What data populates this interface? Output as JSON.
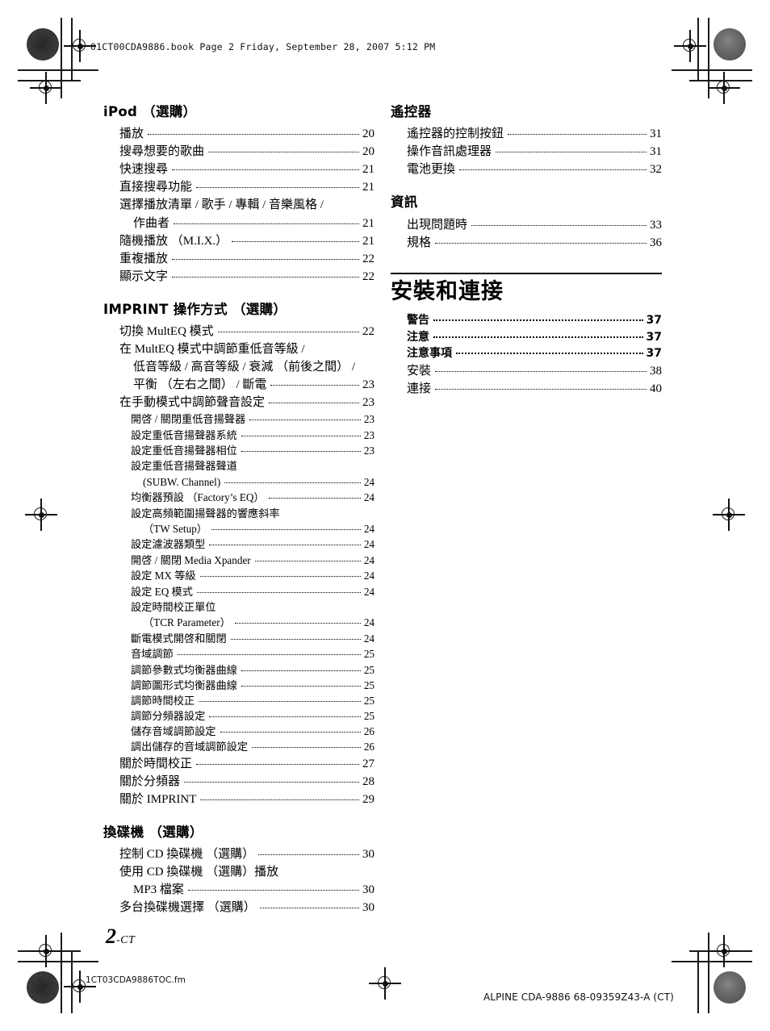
{
  "page": {
    "book_header": "01CT00CDA9886.book  Page 2  Friday, September 28, 2007  5:12 PM",
    "folio_number": "2",
    "folio_suffix": "-CT",
    "footer_file": "1CT03CDA9886TOC.fm",
    "footer_right": "ALPINE CDA-9886 68-09359Z43-A (CT)"
  },
  "left_column": {
    "sections": [
      {
        "title": "iPod （選購）",
        "entries": [
          {
            "label": "播放",
            "page": "20",
            "level": 1
          },
          {
            "label": "搜尋想要的歌曲",
            "page": "20",
            "level": 1
          },
          {
            "label": "快速搜尋",
            "page": "21",
            "level": 1
          },
          {
            "label": "直接搜尋功能",
            "page": "21",
            "level": 1
          },
          {
            "label": "選擇播放清單 / 歌手 / 專輯 / 音樂風格 /",
            "cont": "作曲者",
            "page": "21",
            "level": 1
          },
          {
            "label": "隨機播放 （M.I.X.）",
            "page": "21",
            "level": 1
          },
          {
            "label": "重複播放",
            "page": "22",
            "level": 1
          },
          {
            "label": "顯示文字",
            "page": "22",
            "level": 1
          }
        ]
      },
      {
        "title": "IMPRINT 操作方式 （選購）",
        "entries": [
          {
            "label": "切換 MultEQ 模式",
            "page": "22",
            "level": 1
          },
          {
            "label": "在 MultEQ 模式中調節重低音等級 /",
            "cont": "低音等級 / 高音等級 / 衰減 （前後之間） /",
            "cont2": "平衡 （左右之間） / 斷電",
            "page": "23",
            "level": 1
          },
          {
            "label": "在手動模式中調節聲音設定",
            "page": "23",
            "level": 1
          },
          {
            "label": "開啓 / 關閉重低音揚聲器",
            "page": "23",
            "level": 2
          },
          {
            "label": "設定重低音揚聲器系統",
            "page": "23",
            "level": 2
          },
          {
            "label": "設定重低音揚聲器相位",
            "page": "23",
            "level": 2
          },
          {
            "label": "設定重低音揚聲器聲道",
            "cont": "(SUBW. Channel)",
            "page": "24",
            "level": 2
          },
          {
            "label": "均衡器預設 （Factory’s EQ）",
            "page": "24",
            "level": 2
          },
          {
            "label": "設定高頻範圍揚聲器的響應斜率",
            "cont": "（TW Setup）",
            "page": "24",
            "level": 2
          },
          {
            "label": "設定濾波器類型",
            "page": "24",
            "level": 2
          },
          {
            "label": "開啓 / 關閉 Media Xpander",
            "page": "24",
            "level": 2
          },
          {
            "label": "設定 MX 等級",
            "page": "24",
            "level": 2
          },
          {
            "label": "設定 EQ 模式",
            "page": "24",
            "level": 2
          },
          {
            "label": "設定時間校正單位",
            "cont": "（TCR Parameter）",
            "page": "24",
            "level": 2
          },
          {
            "label": "斷電模式開啓和關閉",
            "page": "24",
            "level": 2
          },
          {
            "label": "音域調節",
            "page": "25",
            "level": 2
          },
          {
            "label": "調節參數式均衡器曲線",
            "page": "25",
            "level": 3
          },
          {
            "label": "調節圖形式均衡器曲線",
            "page": "25",
            "level": 3
          },
          {
            "label": "調節時間校正",
            "page": "25",
            "level": 3
          },
          {
            "label": "調節分頻器設定",
            "page": "25",
            "level": 3
          },
          {
            "label": "儲存音域調節設定",
            "page": "26",
            "level": 3
          },
          {
            "label": "調出儲存的音域調節設定",
            "page": "26",
            "level": 3
          },
          {
            "label": "關於時間校正",
            "page": "27",
            "level": 1
          },
          {
            "label": "關於分頻器",
            "page": "28",
            "level": 1
          },
          {
            "label": "關於 IMPRINT",
            "page": "29",
            "level": 1
          }
        ]
      },
      {
        "title": "換碟機 （選購）",
        "entries": [
          {
            "label": "控制 CD 換碟機 （選購）",
            "page": "30",
            "level": 1
          },
          {
            "label": "使用 CD 換碟機 （選購）播放",
            "cont": "MP3 檔案",
            "page": "30",
            "level": 1
          },
          {
            "label": "多台換碟機選擇 （選購）",
            "page": "30",
            "level": 1
          }
        ]
      }
    ]
  },
  "right_column": {
    "sections": [
      {
        "title": "遙控器",
        "entries": [
          {
            "label": "遙控器的控制按鈕",
            "page": "31",
            "level": 1
          },
          {
            "label": "操作音訊處理器",
            "page": "31",
            "level": 1
          },
          {
            "label": "電池更換",
            "page": "32",
            "level": 1
          }
        ]
      },
      {
        "title": "資訊",
        "entries": [
          {
            "label": "出現問題時",
            "page": "33",
            "level": 1
          },
          {
            "label": "規格",
            "page": "36",
            "level": 1
          }
        ]
      }
    ],
    "big_section": {
      "title": "安裝和連接",
      "entries": [
        {
          "label": "警告",
          "page": "37",
          "level": 1,
          "bold": true
        },
        {
          "label": "注意",
          "page": "37",
          "level": 1,
          "bold": true
        },
        {
          "label": "注意事項",
          "page": "37",
          "level": 1,
          "bold": true
        },
        {
          "label": "安裝",
          "page": "38",
          "level": 1,
          "bold": false
        },
        {
          "label": "連接",
          "page": "40",
          "level": 1,
          "bold": false
        }
      ]
    }
  }
}
